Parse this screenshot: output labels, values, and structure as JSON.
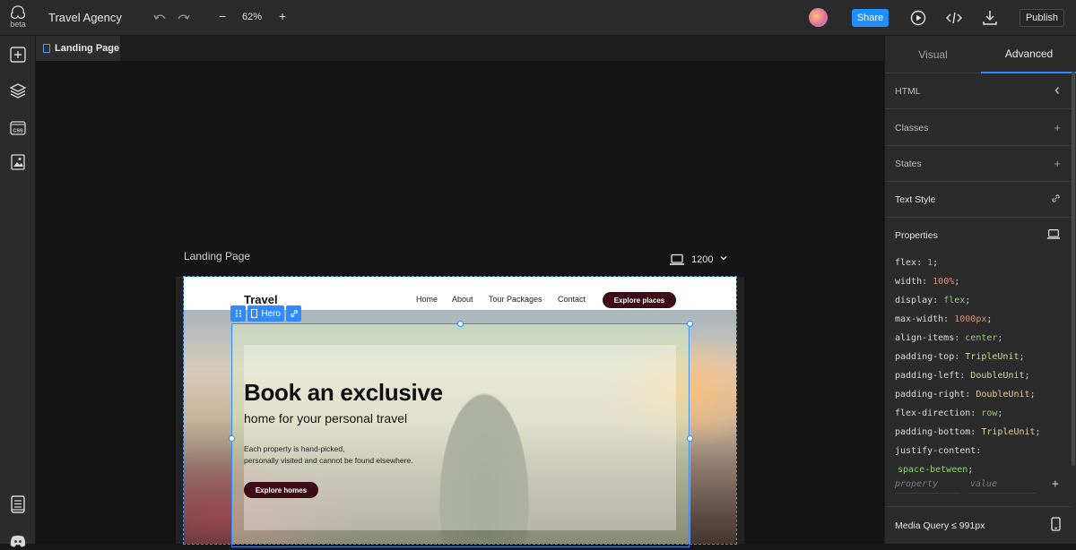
{
  "app": {
    "logo_sub": "beta",
    "project_title": "Travel Agency"
  },
  "toolbar": {
    "zoom_minus": "−",
    "zoom": "62%",
    "zoom_plus": "+",
    "share": "Share",
    "publish": "Publish"
  },
  "tabs": {
    "active": "Landing Page"
  },
  "canvas": {
    "frame_label": "Landing Page",
    "breakpoint": "1200",
    "breakpoint_caret": "⌄"
  },
  "page": {
    "brand": "Travel",
    "nav": [
      "Home",
      "About",
      "Tour Packages",
      "Contact"
    ],
    "nav_cta": "Explore places",
    "headline": "Book an exclusive",
    "subheadline": "home for your personal travel",
    "body_line1": "Each property is hand-picked,",
    "body_line2": "personally visited and cannot be found elsewhere.",
    "hero_cta": "Explore homes"
  },
  "selection": {
    "label": "Hero"
  },
  "panel": {
    "tabs": [
      "Visual",
      "Advanced"
    ],
    "active_tab": "Advanced",
    "sections": [
      {
        "label": "HTML",
        "action_icon": "chevron-left-icon"
      },
      {
        "label": "Classes",
        "action_icon": "plus-icon"
      },
      {
        "label": "States",
        "action_icon": "plus-icon"
      },
      {
        "label": "Text Style",
        "action_icon": "link-icon"
      },
      {
        "label": "Properties",
        "action_icon": "laptop-icon"
      }
    ],
    "properties": [
      {
        "key": "flex",
        "value": "1",
        "type": "num"
      },
      {
        "key": "width",
        "value": "100%",
        "type": "num"
      },
      {
        "key": "display",
        "value": "flex",
        "type": "str"
      },
      {
        "key": "max-width",
        "value": "1000px",
        "type": "num"
      },
      {
        "key": "align-items",
        "value": "center",
        "type": "str"
      },
      {
        "key": "padding-top",
        "value": "TripleUnit",
        "type": "fn"
      },
      {
        "key": "padding-left",
        "value": "DoubleUnit",
        "type": "fn"
      },
      {
        "key": "padding-right",
        "value": "DoubleUnit",
        "type": "fn"
      },
      {
        "key": "flex-direction",
        "value": "row",
        "type": "str"
      },
      {
        "key": "padding-bottom",
        "value": "TripleUnit",
        "type": "fn"
      },
      {
        "key": "justify-content",
        "value": "space-between",
        "type": "str"
      }
    ],
    "new_property_placeholder": "property",
    "new_value_placeholder": "value",
    "media_query": "Media Query ≤ 991px"
  },
  "colors": {
    "accent": "#2f8bff",
    "cta": "#3b0c17",
    "panel_bg": "#2b2b2b"
  }
}
